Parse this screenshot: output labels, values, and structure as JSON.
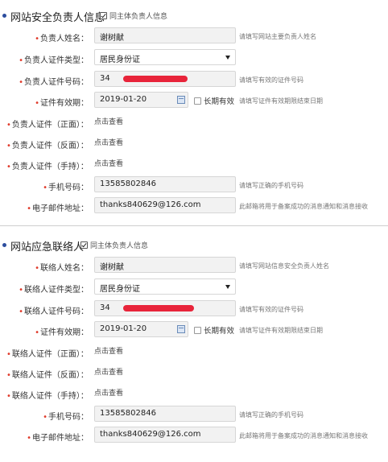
{
  "section1": {
    "title": "网站安全负责人信息",
    "same_as_main": "同主体负责人信息",
    "name": {
      "label": "负责人姓名：",
      "value": "谢树献",
      "hint": "请填写网站主要负责人姓名"
    },
    "id_type": {
      "label": "负责人证件类型：",
      "value": "居民身份证"
    },
    "id_number": {
      "label": "负责人证件号码：",
      "value": "34",
      "hint": "请填写有效的证件号码"
    },
    "validity": {
      "label": "证件有效期：",
      "value": "2019-01-20",
      "long_term": "长期有效",
      "hint": "请填写证件有效期限结束日期"
    },
    "id_front": {
      "label": "负责人证件（正面）：",
      "link": "点击查看"
    },
    "id_back": {
      "label": "负责人证件（反面）：",
      "link": "点击查看"
    },
    "id_hand": {
      "label": "负责人证件（手持）：",
      "link": "点击查看"
    },
    "phone": {
      "label": "手机号码：",
      "value": "13585802846",
      "hint": "请填写正确的手机号码"
    },
    "email": {
      "label": "电子邮件地址：",
      "value": "thanks840629@126.com",
      "hint": "此邮箱将用于备案成功的消息通知和消息接收"
    }
  },
  "section2": {
    "title": "网站应急联络人",
    "same_as_main": "同主体负责人信息",
    "name": {
      "label": "联络人姓名：",
      "value": "谢树献",
      "hint": "请填写网站信息安全负责人姓名"
    },
    "id_type": {
      "label": "联络人证件类型：",
      "value": "居民身份证"
    },
    "id_number": {
      "label": "联络人证件号码：",
      "value": "34",
      "hint": "请填写有效的证件号码"
    },
    "validity": {
      "label": "证件有效期：",
      "value": "2019-01-20",
      "long_term": "长期有效",
      "hint": "请填写证件有效期限结束日期"
    },
    "id_front": {
      "label": "联络人证件（正面）：",
      "link": "点击查看"
    },
    "id_back": {
      "label": "联络人证件（反面）：",
      "link": "点击查看"
    },
    "id_hand": {
      "label": "联络人证件（手持）：",
      "link": "点击查看"
    },
    "phone": {
      "label": "手机号码：",
      "value": "13585802846",
      "hint": "请填写正确的手机号码"
    },
    "email": {
      "label": "电子邮件地址：",
      "value": "thanks840629@126.com",
      "hint": "此邮箱将用于备案成功的消息通知和消息接收"
    }
  },
  "colors": {
    "required": "#e03a2a",
    "redaction": "#e8243a",
    "section_dot": "#2c4d9e"
  }
}
